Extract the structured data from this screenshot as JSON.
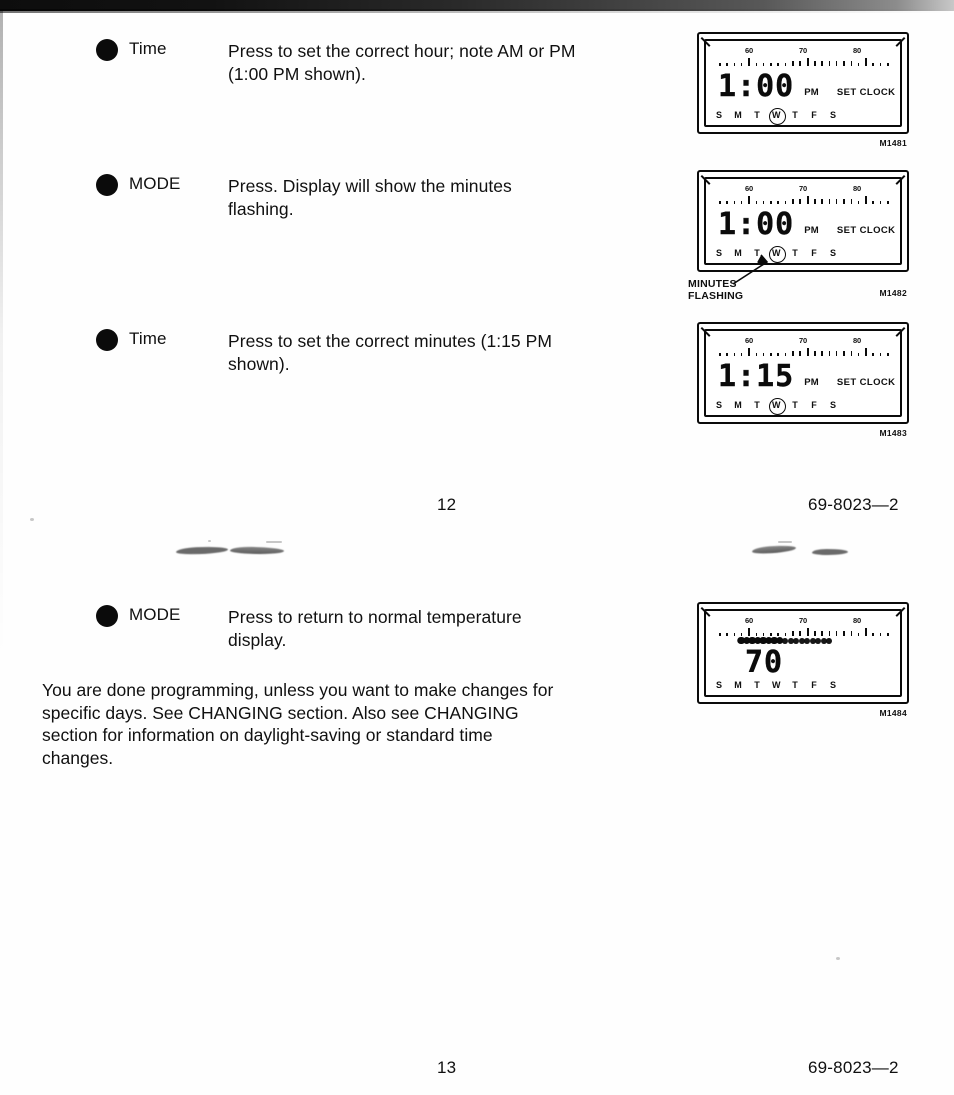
{
  "document": {
    "form_number": "69-8023—2",
    "page_top": "12",
    "page_bottom": "13"
  },
  "steps": [
    {
      "button": "Time",
      "text": "Press to set the correct hour; note AM or PM\n(1:00 PM shown)."
    },
    {
      "button": "MODE",
      "text": "Press. Display will show the minutes\nflashing."
    },
    {
      "button": "Time",
      "text": "Press to set the correct minutes (1:15 PM\nshown)."
    },
    {
      "button": "MODE",
      "text": "Press to return to normal temperature\ndisplay."
    }
  ],
  "paragraph": "You are done programming, unless you want to make changes for\nspecific days. See CHANGING section. Also see CHANGING\nsection for information on daylight-saving or standard time\nchanges.",
  "figures": [
    {
      "code": "M1481",
      "scale_labels": [
        "60",
        "70",
        "80"
      ],
      "digits": "1:00",
      "ampm": "PM",
      "mode_word": "SET CLOCK",
      "days": [
        "S",
        "M",
        "T",
        "W",
        "T",
        "F",
        "S"
      ],
      "active_day_index": 3,
      "bar_filled": false,
      "callout": null
    },
    {
      "code": "M1482",
      "scale_labels": [
        "60",
        "70",
        "80"
      ],
      "digits": "1:00",
      "ampm": "PM",
      "mode_word": "SET CLOCK",
      "days": [
        "S",
        "M",
        "T",
        "W",
        "T",
        "F",
        "S"
      ],
      "active_day_index": 3,
      "bar_filled": false,
      "callout": "MINUTES\nFLASHING"
    },
    {
      "code": "M1483",
      "scale_labels": [
        "60",
        "70",
        "80"
      ],
      "digits": "1:15",
      "ampm": "PM",
      "mode_word": "SET CLOCK",
      "days": [
        "S",
        "M",
        "T",
        "W",
        "T",
        "F",
        "S"
      ],
      "active_day_index": 3,
      "bar_filled": false,
      "callout": null
    },
    {
      "code": "M1484",
      "scale_labels": [
        "60",
        "70",
        "80"
      ],
      "digits": "70",
      "ampm": "",
      "mode_word": "",
      "days": [
        "S",
        "M",
        "T",
        "W",
        "T",
        "F",
        "S"
      ],
      "active_day_index": -1,
      "bar_filled": true,
      "callout": null
    }
  ]
}
